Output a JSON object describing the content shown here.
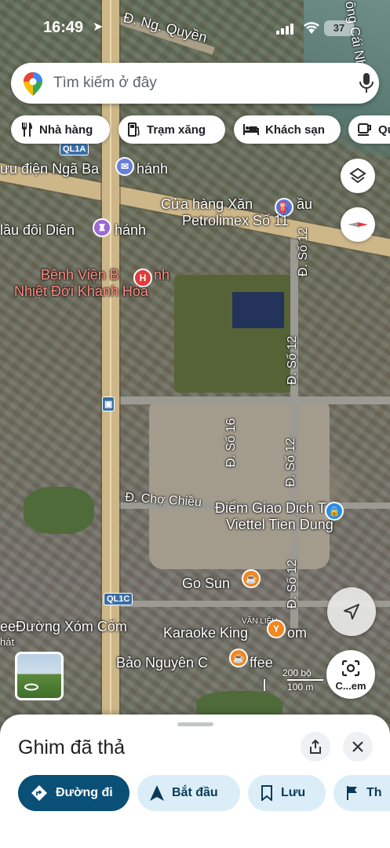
{
  "status_bar": {
    "time": "16:49",
    "battery": "37"
  },
  "search": {
    "placeholder": "Tìm kiếm ở đây"
  },
  "chips": [
    {
      "label": "Nhà hàng",
      "icon": "restaurant-icon"
    },
    {
      "label": "Trạm xăng",
      "icon": "gas-station-icon"
    },
    {
      "label": "Khách sạn",
      "icon": "hotel-icon"
    },
    {
      "label": "Qu",
      "icon": "cafe-icon"
    }
  ],
  "map_labels": {
    "road_top": "Đ. Ng. Quyền",
    "ql1a": "QL1A",
    "post_office": "ưu điện Ngã Ba",
    "post_office_tail": "hánh",
    "gas_store_1": "Cửa hàng Xăn",
    "gas_store_1b": "ầu",
    "gas_store_2": "Petrolimex Số 11",
    "church": "lầu đôi Diên",
    "church_tail": "hánh",
    "hospital_1": "Bệnh Viện B",
    "hospital_1b": "nh",
    "hospital_2": "Nhiệt Đới Khánh Hòa",
    "so12_top": "Đ. Số 12",
    "so12_mid": "Đ. Số 12",
    "so16": "Đ. Số 16",
    "so12_lower": "Đ. Số 12",
    "so12_bottom": "Đ. Số 12",
    "cho_chieu": "Đ. Chợ Chiều",
    "viettel_1": "Điểm Giao Dịch Tại",
    "viettel_2": "Viettel Tien Dung",
    "go_sun": "Go Sun",
    "ql1c": "QL1C",
    "van_lieu": "VĂN LIỆU",
    "xom_com": "eeĐường Xóm Cốm",
    "hat": "hát",
    "karaoke": "Karaoke King",
    "karaoke_tail": "om",
    "bao_nguyen": "Bảo Nguyên C",
    "bao_nguyen_tail": "ffee",
    "river": "ông Cái Nh",
    "scale_top": "200 bộ",
    "scale_bottom": "100 m"
  },
  "controls": {
    "lens_label": "C...em"
  },
  "sheet": {
    "title": "Ghim đã thả",
    "actions": [
      {
        "label": "Đường đi"
      },
      {
        "label": "Bắt đầu"
      },
      {
        "label": "Lưu"
      },
      {
        "label": "Th"
      }
    ]
  },
  "colors": {
    "primary_action": "#0a4f75",
    "pill_bg": "#dbeef8",
    "hospital": "#e33b3b",
    "gas_poi": "#5b73d8",
    "food_poi": "#f2861f",
    "church_poi": "#9b6ad2",
    "atm_poi": "#2a8ee8"
  }
}
